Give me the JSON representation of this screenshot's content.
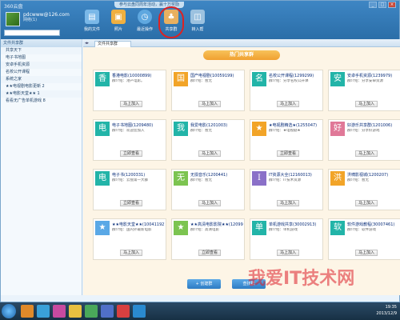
{
  "window": {
    "title": "360云盘",
    "promo": "参与云盘同周年活动，赢十万奖励",
    "controls": [
      "_",
      "□",
      "×"
    ]
  },
  "profile": {
    "name": "pdcwww@126.com",
    "status": "网络(1)",
    "search_placeholder": ""
  },
  "toolbar": {
    "items": [
      {
        "label": "我的文件",
        "icon": "folder-icon",
        "color": "#7ab8e8"
      },
      {
        "label": "照片",
        "icon": "photo-icon",
        "color": "#f0b040"
      },
      {
        "label": "最近操作",
        "icon": "clock-icon",
        "color": "#5fa8e0"
      },
      {
        "label": "共享群",
        "icon": "share-group-icon",
        "color": "#e8b060"
      },
      {
        "label": "转入帮",
        "icon": "disk-icon",
        "color": "#9cc2e0"
      }
    ]
  },
  "sidebar": {
    "header": "文件共享群",
    "items": [
      {
        "label": "共享天下"
      },
      {
        "label": "电子书地图"
      },
      {
        "label": "安卓手机资源"
      },
      {
        "label": "名校公开课程"
      },
      {
        "label": "系统之家"
      },
      {
        "label": "★★电视剧电影更新 2"
      },
      {
        "label": "★★电影天堂★★ 1"
      },
      {
        "label": "看看无广告单机游戏 8"
      }
    ]
  },
  "main": {
    "tab": "文件共享群",
    "banner": "热门共享群",
    "join_label": "马上加入",
    "view_label": "立即查看",
    "cards": [
      {
        "glyph": "香",
        "color": "#22b4a8",
        "name": "香港电影(10000899)",
        "desc": "群介绍：港产电影。",
        "btn": "马上加入"
      },
      {
        "glyph": "国",
        "color": "#f2a428",
        "name": "国产电视剧(10059199)",
        "desc": "群介绍：暂无",
        "btn": "马上加入"
      },
      {
        "glyph": "名",
        "color": "#22b4a8",
        "name": "名校公开课程(1299299)",
        "desc": "群介绍：分享名校公开课",
        "btn": "马上加入"
      },
      {
        "glyph": "安",
        "color": "#22b4a8",
        "name": "安卓手机资源(1239979)",
        "desc": "群介绍：分享安卓资源",
        "btn": "马上加入"
      },
      {
        "glyph": "电",
        "color": "#22b4a8",
        "name": "电子书地图(1209480)",
        "desc": "群介绍：欢迎您加入",
        "btn": "立即查看"
      },
      {
        "glyph": "我",
        "color": "#22b4a8",
        "name": "我爱电影(1201003)",
        "desc": "群介绍：暂无",
        "btn": "马上加入"
      },
      {
        "glyph": "★",
        "color": "#f2a428",
        "name": "★电视剧精选★(1255047)",
        "desc": "群介绍：★电视剧★",
        "btn": "立即查看"
      },
      {
        "glyph": "好",
        "color": "#e07898",
        "name": "好游乐共享群(1201006)",
        "desc": "群介绍：分享好游戏",
        "btn": "马上加入"
      },
      {
        "glyph": "电",
        "color": "#22b4a8",
        "name": "电子书(1200331)",
        "desc": "群介绍：云盘第一大群",
        "btn": "立即查看"
      },
      {
        "glyph": "无",
        "color": "#7cc450",
        "name": "无损音乐(1200441)",
        "desc": "群介绍：暂无",
        "btn": "马上加入"
      },
      {
        "glyph": "I",
        "color": "#8a70c8",
        "name": "IT资源大全(12160013)",
        "desc": "群介绍：IT技术资源",
        "btn": "马上加入"
      },
      {
        "glyph": "洪",
        "color": "#f2a428",
        "name": "洪啸影视城(1200207)",
        "desc": "群介绍：暂无",
        "btn": "马上加入"
      },
      {
        "glyph": "★",
        "color": "#5aa8e6",
        "name": "★★电影天堂★★(10041192)",
        "desc": "群介绍：国内外最新电影",
        "btn": "马上加入"
      },
      {
        "glyph": "★",
        "color": "#7cc450",
        "name": "★★高清电影影院★★(12099009)",
        "desc": "群介绍：高清电影",
        "btn": "立即查看"
      },
      {
        "glyph": "单",
        "color": "#22b4a8",
        "name": "单机游戏共享(30002913)",
        "desc": "群介绍：单机游戏",
        "btn": "马上加入"
      },
      {
        "glyph": "软",
        "color": "#22b4a8",
        "name": "软件游戏教程(30007461)",
        "desc": "群介绍：软件游戏",
        "btn": "马上加入"
      }
    ],
    "bottom_buttons": [
      "+ 创建群",
      "查找群"
    ]
  },
  "taskbar": {
    "time": "19:35",
    "date": "2013/12/9",
    "icons": [
      "#e08a2a",
      "#3aa0d8",
      "#c84aa0",
      "#e8c040",
      "#4aa85a",
      "#5070c8",
      "#d84040",
      "#2a8ad0"
    ]
  },
  "watermark": "我爱IT技术网"
}
